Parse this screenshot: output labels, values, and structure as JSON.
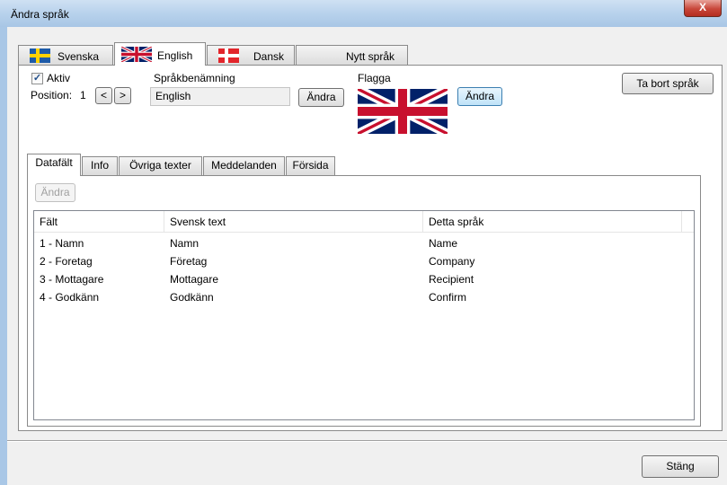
{
  "window": {
    "title": "Ändra språk",
    "close_label": "X"
  },
  "lang_tabs": [
    {
      "label": "Svenska",
      "flag": "sweden-flag-icon"
    },
    {
      "label": "English",
      "flag": "uk-flag-icon"
    },
    {
      "label": "Dansk",
      "flag": "denmark-flag-icon"
    },
    {
      "label": "Nytt språk"
    }
  ],
  "language": {
    "active_label": "Aktiv",
    "active_checked": true,
    "position_label": "Position:",
    "position_value": "1",
    "prev_glyph": "<",
    "next_glyph": ">",
    "name_label": "Språkbenämning",
    "name_value": "English",
    "name_change_label": "Ändra",
    "flag_label": "Flagga",
    "flag_change_label": "Ändra",
    "delete_label": "Ta bort språk"
  },
  "inner_tabs": [
    "Datafält",
    "Info",
    "Övriga texter",
    "Meddelanden",
    "Försida"
  ],
  "datafalt": {
    "change_label": "Ändra",
    "columns": [
      "Fält",
      "Svensk text",
      "Detta språk"
    ],
    "rows": [
      [
        "1 - Namn",
        "Namn",
        "Name"
      ],
      [
        "2 - Foretag",
        "Företag",
        "Company"
      ],
      [
        "3 - Mottagare",
        "Mottagare",
        "Recipient"
      ],
      [
        "4 - Godkänn",
        "Godkänn",
        "Confirm"
      ]
    ]
  },
  "footer": {
    "close_label": "Stäng"
  },
  "colors": {
    "accent": "#3c7fb1",
    "titlebar": "#b8d2ec",
    "close": "#c8473a"
  }
}
